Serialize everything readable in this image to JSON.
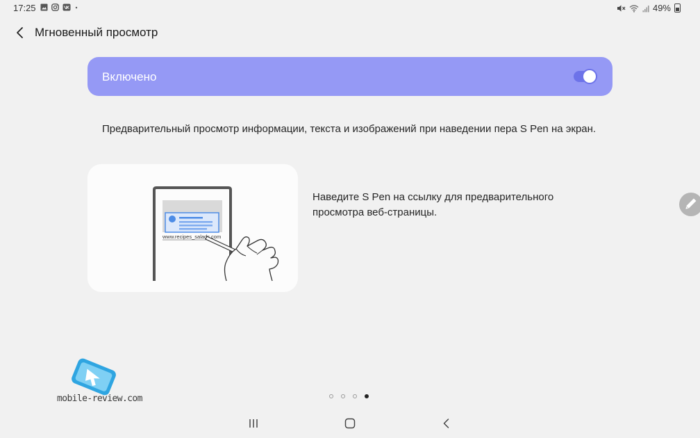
{
  "status_bar": {
    "time": "17:25",
    "battery": "49%",
    "left_icons": [
      "gallery-icon",
      "instagram-icon",
      "vk-icon",
      "dot-icon"
    ],
    "right_icons": [
      "mute-icon",
      "wifi-icon",
      "signal-icon",
      "battery-icon"
    ]
  },
  "header": {
    "title": "Мгновенный просмотр",
    "back_icon": "back-arrow-icon"
  },
  "switch": {
    "label": "Включено",
    "state": "on",
    "card_color": "#9599f5",
    "toggle_color": "#6d73e9"
  },
  "description": "Предварительный просмотр информации, текста и изображений при наведении пера S Pen на экран.",
  "illustration": {
    "url_text": "www.recipes_salads.com"
  },
  "hint": "Наведите S Pen на ссылку для предварительного просмотра веб-страницы.",
  "watermark": "mobile-review.com",
  "pagination": {
    "total": 4,
    "current": 4
  },
  "nav_bar": {
    "recents_icon": "recents-icon",
    "home_icon": "home-icon",
    "back_icon": "nav-back-icon"
  }
}
